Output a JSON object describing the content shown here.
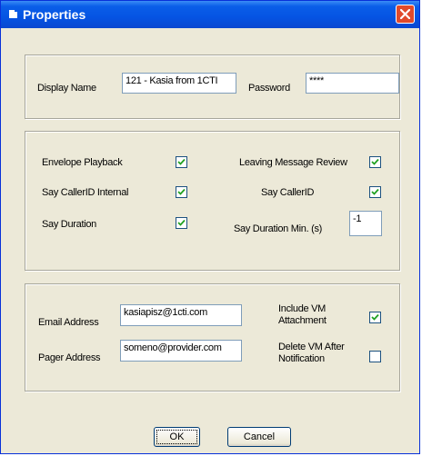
{
  "window": {
    "title": "Properties"
  },
  "identity": {
    "display_name_label": "Display Name",
    "display_name_value": "121 - Kasia from 1CTI",
    "password_label": "Password",
    "password_value": "****"
  },
  "options": {
    "envelope_playback_label": "Envelope Playback",
    "envelope_playback_checked": true,
    "leaving_message_review_label": "Leaving Message Review",
    "leaving_message_review_checked": true,
    "say_callerid_internal_label": "Say CallerID Internal",
    "say_callerid_internal_checked": true,
    "say_callerid_label": "Say CallerID",
    "say_callerid_checked": true,
    "say_duration_label": "Say Duration",
    "say_duration_checked": true,
    "say_duration_min_label": "Say Duration Min. (s)",
    "say_duration_min_value": "-1"
  },
  "notification": {
    "email_label": "Email Address",
    "email_value": "kasiapisz@1cti.com",
    "pager_label": "Pager Address",
    "pager_value": "someno@provider.com",
    "include_vm_label_line1": "Include VM",
    "include_vm_label_line2": "Attachment",
    "include_vm_checked": true,
    "delete_vm_label_line1": "Delete VM After",
    "delete_vm_label_line2": "Notification",
    "delete_vm_checked": false
  },
  "buttons": {
    "ok_label": "OK",
    "cancel_label": "Cancel"
  },
  "colors": {
    "title_bar": "#0554e3",
    "close_button": "#e04a2c",
    "dialog_bg": "#ece9d8"
  }
}
